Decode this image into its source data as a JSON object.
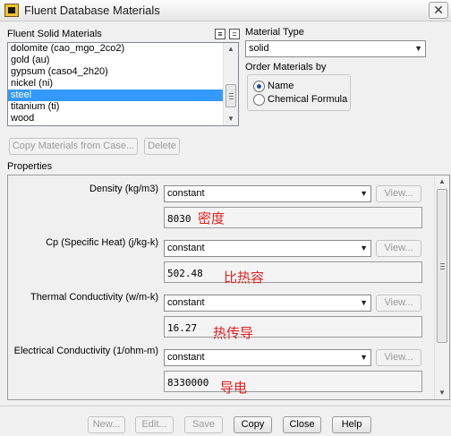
{
  "window": {
    "title": "Fluent Database Materials",
    "close_glyph": "✕"
  },
  "solid_materials": {
    "label": "Fluent Solid Materials",
    "items": [
      "dolomite (cao_mgo_2co2)",
      "gold (au)",
      "gypsum (caso4_2h20)",
      "nickel (ni)",
      "steel",
      "titanium (ti)",
      "wood"
    ],
    "selected": "steel",
    "select_all_glyph": "≡",
    "deselect_all_glyph": "="
  },
  "material_type": {
    "label": "Material Type",
    "value": "solid"
  },
  "order_by": {
    "label": "Order Materials by",
    "options": [
      {
        "label": "Name",
        "checked": true
      },
      {
        "label": "Chemical Formula",
        "checked": false
      }
    ]
  },
  "actions": {
    "copy_from_case": "Copy Materials from Case...",
    "delete": "Delete"
  },
  "properties": {
    "label": "Properties",
    "view_label": "View...",
    "items": [
      {
        "label": "Density (kg/m3)",
        "method": "constant",
        "value": "8030",
        "annotation": "密度"
      },
      {
        "label": "Cp (Specific Heat) (j/kg-k)",
        "method": "constant",
        "value": "502.48",
        "annotation": "比热容"
      },
      {
        "label": "Thermal Conductivity (w/m-k)",
        "method": "constant",
        "value": "16.27",
        "annotation": "热传导"
      },
      {
        "label": "Electrical Conductivity (1/ohm-m)",
        "method": "constant",
        "value": "8330000",
        "annotation": "导电"
      }
    ]
  },
  "footer": {
    "new": "New...",
    "edit": "Edit...",
    "save": "Save",
    "copy": "Copy",
    "close": "Close",
    "help": "Help"
  },
  "icons": {
    "dropdown": "▼",
    "scroll_up": "▲",
    "scroll_down": "▼"
  },
  "colors": {
    "selection": "#3399ff",
    "annotation": "#e02020"
  }
}
